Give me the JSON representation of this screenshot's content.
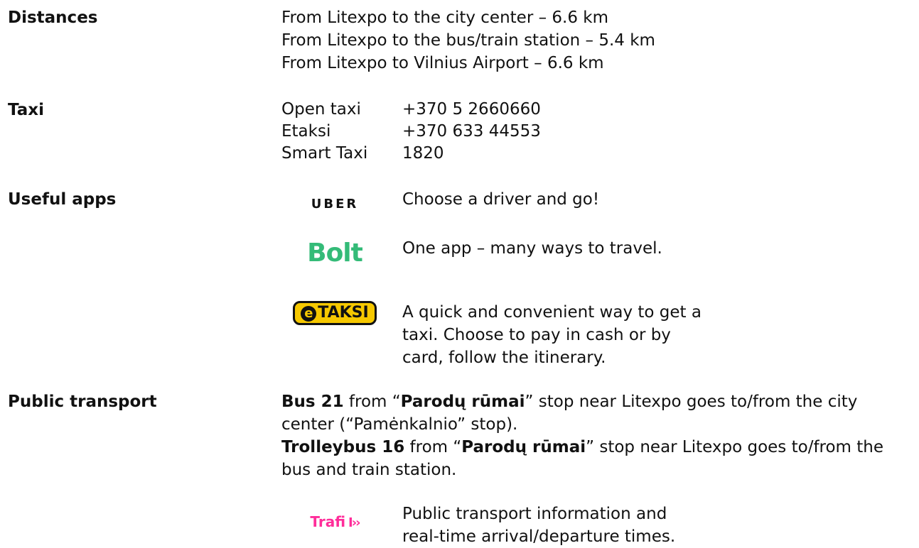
{
  "distances": {
    "label": "Distances",
    "lines": [
      "From Litexpo to the city center – 6.6 km",
      "From Litexpo to the bus/train station – 5.4 km",
      "From Litexpo to Vilnius Airport – 6.6 km"
    ]
  },
  "taxi": {
    "label": "Taxi",
    "entries": [
      {
        "name": "Open taxi",
        "phone": "+370 5 2660660"
      },
      {
        "name": "Etaksi",
        "phone": "+370 633 44553"
      },
      {
        "name": "Smart Taxi",
        "phone": "1820"
      }
    ]
  },
  "apps": {
    "label": "Useful apps",
    "items": [
      {
        "logo_text": "UBER",
        "logo_icon": "uber-logo-icon",
        "description": "Choose a driver and go!"
      },
      {
        "logo_text": "Bolt",
        "logo_icon": "bolt-logo-icon",
        "logo_color": "#34bb78",
        "description": "One app – many ways to travel."
      },
      {
        "logo_text": "TAKSI",
        "logo_mark": "e",
        "logo_icon": "etaksi-logo-icon",
        "logo_color": "#f6c800",
        "description_lines": [
          "A quick and convenient way to get a",
          "taxi. Choose to pay in cash or by",
          "card, follow the itinerary."
        ]
      }
    ]
  },
  "public_transport": {
    "label": "Public transport",
    "bus": {
      "route": "Bus 21",
      "t1": " from “",
      "stop": "Parodų rūmai",
      "t2": "” stop near Litexpo goes to/from the city",
      "line2": "center (“Pamėnkalnio” stop)."
    },
    "trolley": {
      "route": "Trolleybus 16",
      "t1": " from “",
      "stop": "Parodų rūmai",
      "t2": "” stop near Litexpo goes to/from the",
      "line2": "bus and train station."
    },
    "app": {
      "logo_text": "Trafi",
      "logo_arrow": "I››",
      "logo_icon": "trafi-logo-icon",
      "logo_color": "#ff2d9a",
      "description_lines": [
        "Public transport information and",
        "real-time arrival/departure times."
      ]
    }
  }
}
